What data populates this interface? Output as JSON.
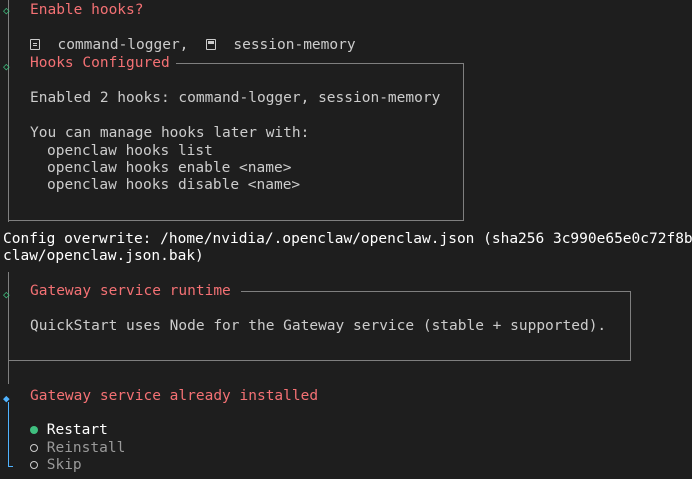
{
  "hooks_prompt": {
    "title": "Enable hooks?",
    "selected": [
      "command-logger,",
      "session-memory"
    ]
  },
  "hooks_panel": {
    "title": "Hooks Configured",
    "summary": "Enabled 2 hooks: command-logger, session-memory",
    "manage_intro": "You can manage hooks later with:",
    "commands": [
      "openclaw hooks list",
      "openclaw hooks enable <name>",
      "openclaw hooks disable <name>"
    ]
  },
  "config_message": {
    "line1": "Config overwrite: /home/nvidia/.openclaw/openclaw.json (sha256 3c990e65e0c72f8b",
    "line2": "claw/openclaw.json.bak)"
  },
  "runtime_panel": {
    "title": "Gateway service runtime",
    "message": "QuickStart uses Node for the Gateway service (stable + supported)."
  },
  "installed_prompt": {
    "title": "Gateway service already installed",
    "options": [
      {
        "label": "Restart",
        "selected": true
      },
      {
        "label": "Reinstall",
        "selected": false
      },
      {
        "label": "Skip",
        "selected": false
      }
    ]
  },
  "colors": {
    "background": "#1e1e1e",
    "heading": "#f47174",
    "diamond_done": "#3fbf7f",
    "diamond_active": "#4fb3ff",
    "selected_dot": "#3fbf7f",
    "border": "#7f7f7f"
  },
  "icons": [
    "gutter-diamond-icon",
    "document-icon",
    "floppy-disk-icon",
    "radio-selected-icon",
    "radio-unselected-icon"
  ]
}
